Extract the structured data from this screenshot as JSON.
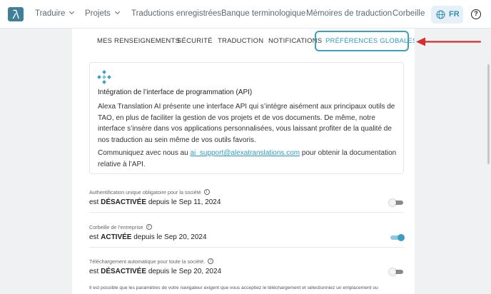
{
  "topnav": {
    "items": [
      {
        "label": "Traduire",
        "has_dropdown": true
      },
      {
        "label": "Projets",
        "has_dropdown": true
      },
      {
        "label": "Traductions enregistrées",
        "has_dropdown": false
      },
      {
        "label": "Banque terminologique",
        "has_dropdown": false
      },
      {
        "label": "Mémoires de traduction",
        "has_dropdown": false
      },
      {
        "label": "Corbeille",
        "has_dropdown": false
      }
    ],
    "language": "FR",
    "help_icon": "question-circle-icon"
  },
  "subtabs": [
    {
      "label": "MES RENSEIGNEMENTS",
      "active": false
    },
    {
      "label": "SÉCURITÉ",
      "active": false
    },
    {
      "label": "TRADUCTION",
      "active": false
    },
    {
      "label": "NOTIFICATIONS",
      "active": false
    },
    {
      "label": "PRÉFÉRENCES GLOBALES",
      "active": true
    }
  ],
  "api": {
    "title": "Intégration de l’interface de programmation (API)",
    "description": "Alexa Translation AI présente une interface API qui s’intègre aisément aux principaux outils de TAO, en plus de faciliter la gestion de vos projets et de vos documents. De même, notre interface s’insère dans vos applications personnalisées, vous laissant profiter de la qualité de nos traduction au sein même de vos outils favoris.",
    "contact_prefix": "Communiquez avec nous au",
    "contact_email": "ai_support@alexatranslations.com",
    "contact_suffix": "pour obtenir la documentation relative à l’API."
  },
  "settings": [
    {
      "label": "Authentification unique obligatoire pour la société",
      "prefix": "est",
      "state": "DÉSACTIVÉE",
      "date_text": "depuis le Sep 11, 2024",
      "enabled": false
    },
    {
      "label": "Corbeille de l’entreprise",
      "prefix": "est",
      "state": "ACTIVÉE",
      "date_text": "depuis le Sep 20, 2024",
      "enabled": true
    },
    {
      "label": "Téléchargement automatique pour toute la société.",
      "prefix": "est",
      "state": "DÉSACTIVÉE",
      "date_text": "depuis le Sep 20, 2024",
      "enabled": false
    }
  ],
  "footnote": "Il est possible que les paramètres de votre navigateur exigent que vous acceptiez le téléchargement et sélectionniez un emplacement ou",
  "colors": {
    "accent": "#3a9fc2",
    "logo": "#3f7f97",
    "arrow": "#d42e2e",
    "highlight_border": "#3aa2bf"
  }
}
